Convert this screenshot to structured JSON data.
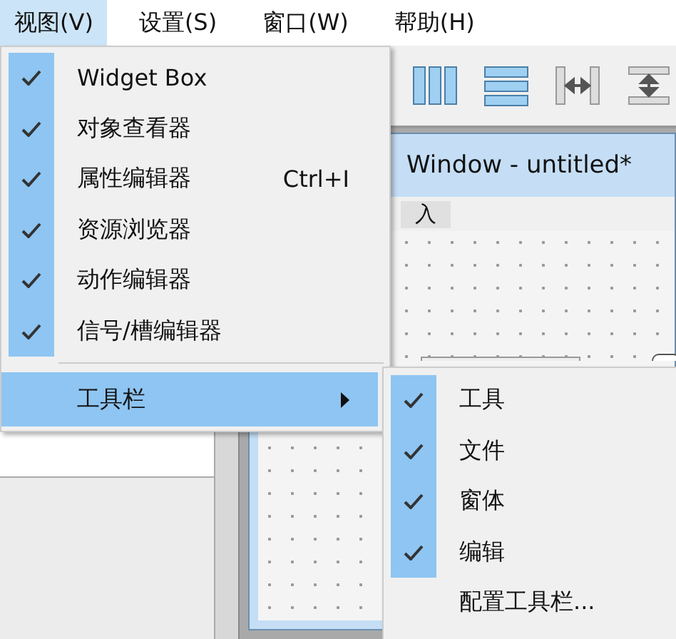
{
  "menubar": [
    {
      "label": "视图(V)",
      "selected": true
    },
    {
      "label": "设置(S)",
      "selected": false
    },
    {
      "label": "窗口(W)",
      "selected": false
    },
    {
      "label": "帮助(H)",
      "selected": false
    }
  ],
  "view_menu": {
    "items": [
      {
        "label": "Widget Box",
        "checked": true
      },
      {
        "label": "对象查看器",
        "checked": true
      },
      {
        "label": "属性编辑器",
        "checked": true,
        "shortcut": "Ctrl+I"
      },
      {
        "label": "资源浏览器",
        "checked": true
      },
      {
        "label": "动作编辑器",
        "checked": true
      },
      {
        "label": "信号/槽编辑器",
        "checked": true
      }
    ],
    "submenu_item": {
      "label": "工具栏",
      "selected": true
    }
  },
  "toolbar_submenu": {
    "items": [
      {
        "label": "工具",
        "checked": true
      },
      {
        "label": "文件",
        "checked": true
      },
      {
        "label": "窗体",
        "checked": true
      },
      {
        "label": "编辑",
        "checked": true
      },
      {
        "label": "配置工具栏...",
        "checked": false
      }
    ]
  },
  "designer": {
    "window_title": "Window - untitled*",
    "form_menu_text": "入"
  }
}
